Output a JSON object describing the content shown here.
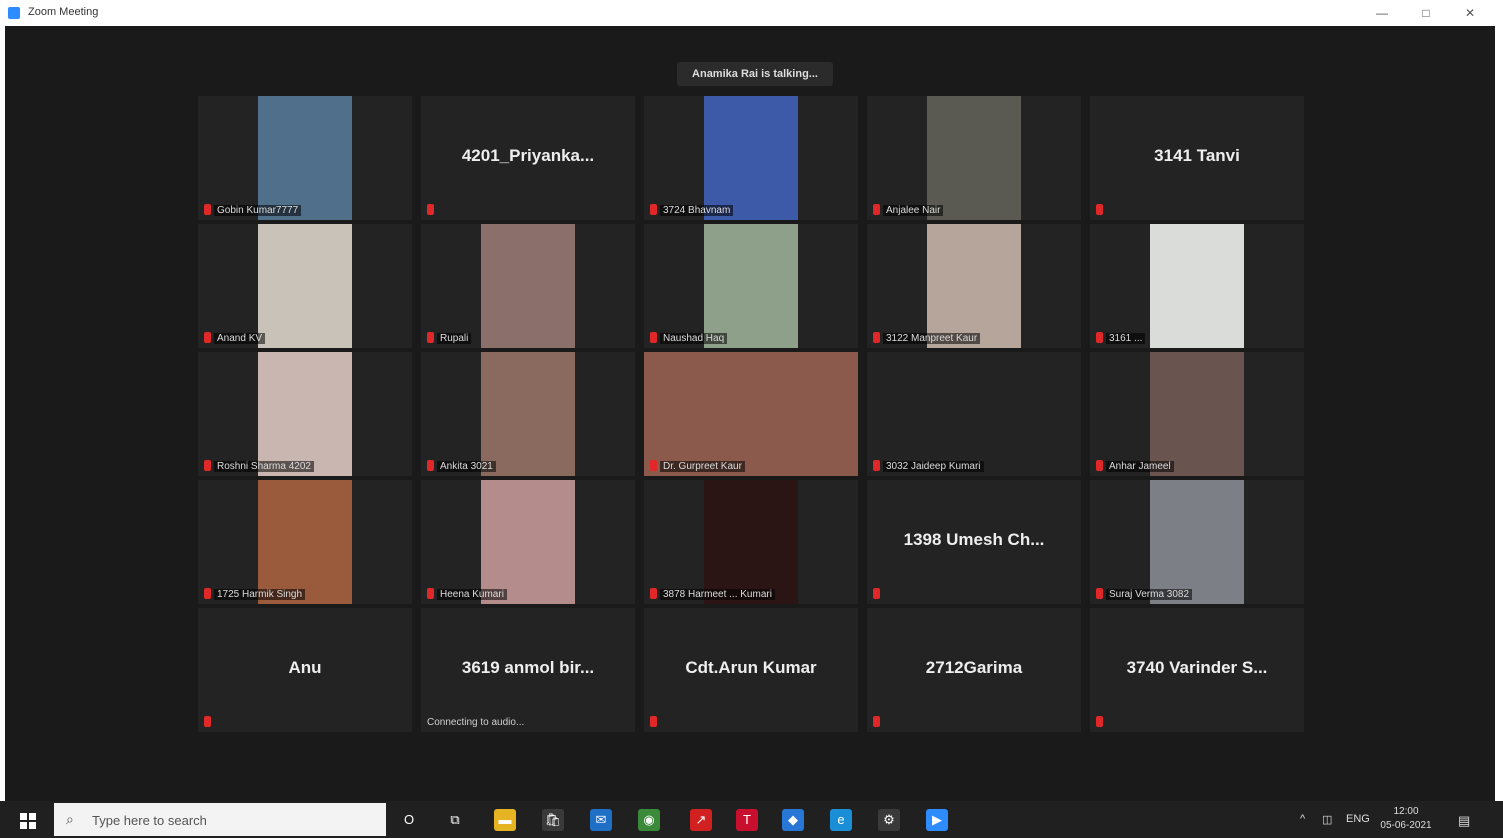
{
  "window": {
    "title": "Zoom Meeting",
    "minimize": "—",
    "maximize": "□",
    "close": "✕"
  },
  "speaker_banner": "Anamika Rai is talking...",
  "tiles": [
    {
      "name": "Gobin Kumar7777",
      "video": "#4f6f8a",
      "big_name": null
    },
    {
      "name": "",
      "video": null,
      "big_name": "4201_Priyanka..."
    },
    {
      "name": "3724 Bhavnam",
      "video": "#3d5aa8",
      "big_name": null
    },
    {
      "name": "Anjalee Nair",
      "video": "#5a5a52",
      "big_name": null
    },
    {
      "name": "",
      "video": null,
      "big_name": "3141 Tanvi"
    },
    {
      "name": "Anand KV",
      "video": "#c9c2b8",
      "big_name": null
    },
    {
      "name": "Rupali",
      "video": "#8a6f6a",
      "big_name": null
    },
    {
      "name": "Naushad Haq",
      "video": "#8fa08a",
      "big_name": null
    },
    {
      "name": "3122 Manpreet Kaur",
      "video": "#b5a59a",
      "big_name": null
    },
    {
      "name": "3161 ...",
      "video": "#d9dcd8",
      "big_name": null
    },
    {
      "name": "Roshni Sharma 4202",
      "video": "#c9b6b0",
      "big_name": null
    },
    {
      "name": "Ankita 3021",
      "video": "#8a6a5e",
      "big_name": null
    },
    {
      "name": "Dr. Gurpreet Kaur",
      "video": "#8b5a4c",
      "big_name": null
    },
    {
      "name": "3032 Jaideep Kumari",
      "video": null,
      "big_name": null
    },
    {
      "name": "Anhar Jameel",
      "video": "#6a5450",
      "big_name": null
    },
    {
      "name": "1725 Harmik Singh",
      "video": "#9a5a3c",
      "big_name": null
    },
    {
      "name": "Heena Kumari",
      "video": "#b58c8c",
      "big_name": null
    },
    {
      "name": "3878 Harmeet ... Kumari",
      "video": "#2a1414",
      "big_name": null
    },
    {
      "name": "",
      "video": null,
      "big_name": "1398 Umesh Ch..."
    },
    {
      "name": "Suraj Verma 3082",
      "video": "#7d7f86",
      "big_name": null
    },
    {
      "name": "",
      "video": null,
      "big_name": "Anu"
    },
    {
      "name": "",
      "video": null,
      "big_name": "3619 anmol bir...",
      "status": "Connecting to audio..."
    },
    {
      "name": "",
      "video": null,
      "big_name": "Cdt.Arun Kumar"
    },
    {
      "name": "",
      "video": null,
      "big_name": "2712Garima"
    },
    {
      "name": "",
      "video": null,
      "big_name": "3740 Varinder S..."
    }
  ],
  "taskbar": {
    "search_placeholder": "Type here to search",
    "search_icon": "search-icon",
    "apps": [
      {
        "name": "task-view-icon",
        "glyph": "O",
        "color": "transparent"
      },
      {
        "name": "multitask-icon",
        "glyph": "⧉",
        "color": "transparent"
      },
      {
        "name": "file-explorer-icon",
        "glyph": "▬",
        "color": "#e6b422"
      },
      {
        "name": "store-icon",
        "glyph": "🛍",
        "color": "#3a3a3a"
      },
      {
        "name": "mail-icon",
        "glyph": "✉",
        "color": "#1f6fc7"
      },
      {
        "name": "chrome-icon",
        "glyph": "◉",
        "color": "#3a8a3a"
      },
      {
        "name": "app-red-icon",
        "glyph": "↗",
        "color": "#d02020"
      },
      {
        "name": "pdf-icon",
        "glyph": "T",
        "color": "#c8102e"
      },
      {
        "name": "blue-app-icon",
        "glyph": "◆",
        "color": "#2876d6"
      },
      {
        "name": "edge-icon",
        "glyph": "e",
        "color": "#1a8fd8"
      },
      {
        "name": "settings-app-icon",
        "glyph": "⚙",
        "color": "#3a3a3a"
      },
      {
        "name": "zoom-icon",
        "glyph": "▶",
        "color": "#2d8cff"
      }
    ],
    "tray_lang": "ENG",
    "clock_time": "12:00",
    "clock_date": "05-06-2021"
  }
}
